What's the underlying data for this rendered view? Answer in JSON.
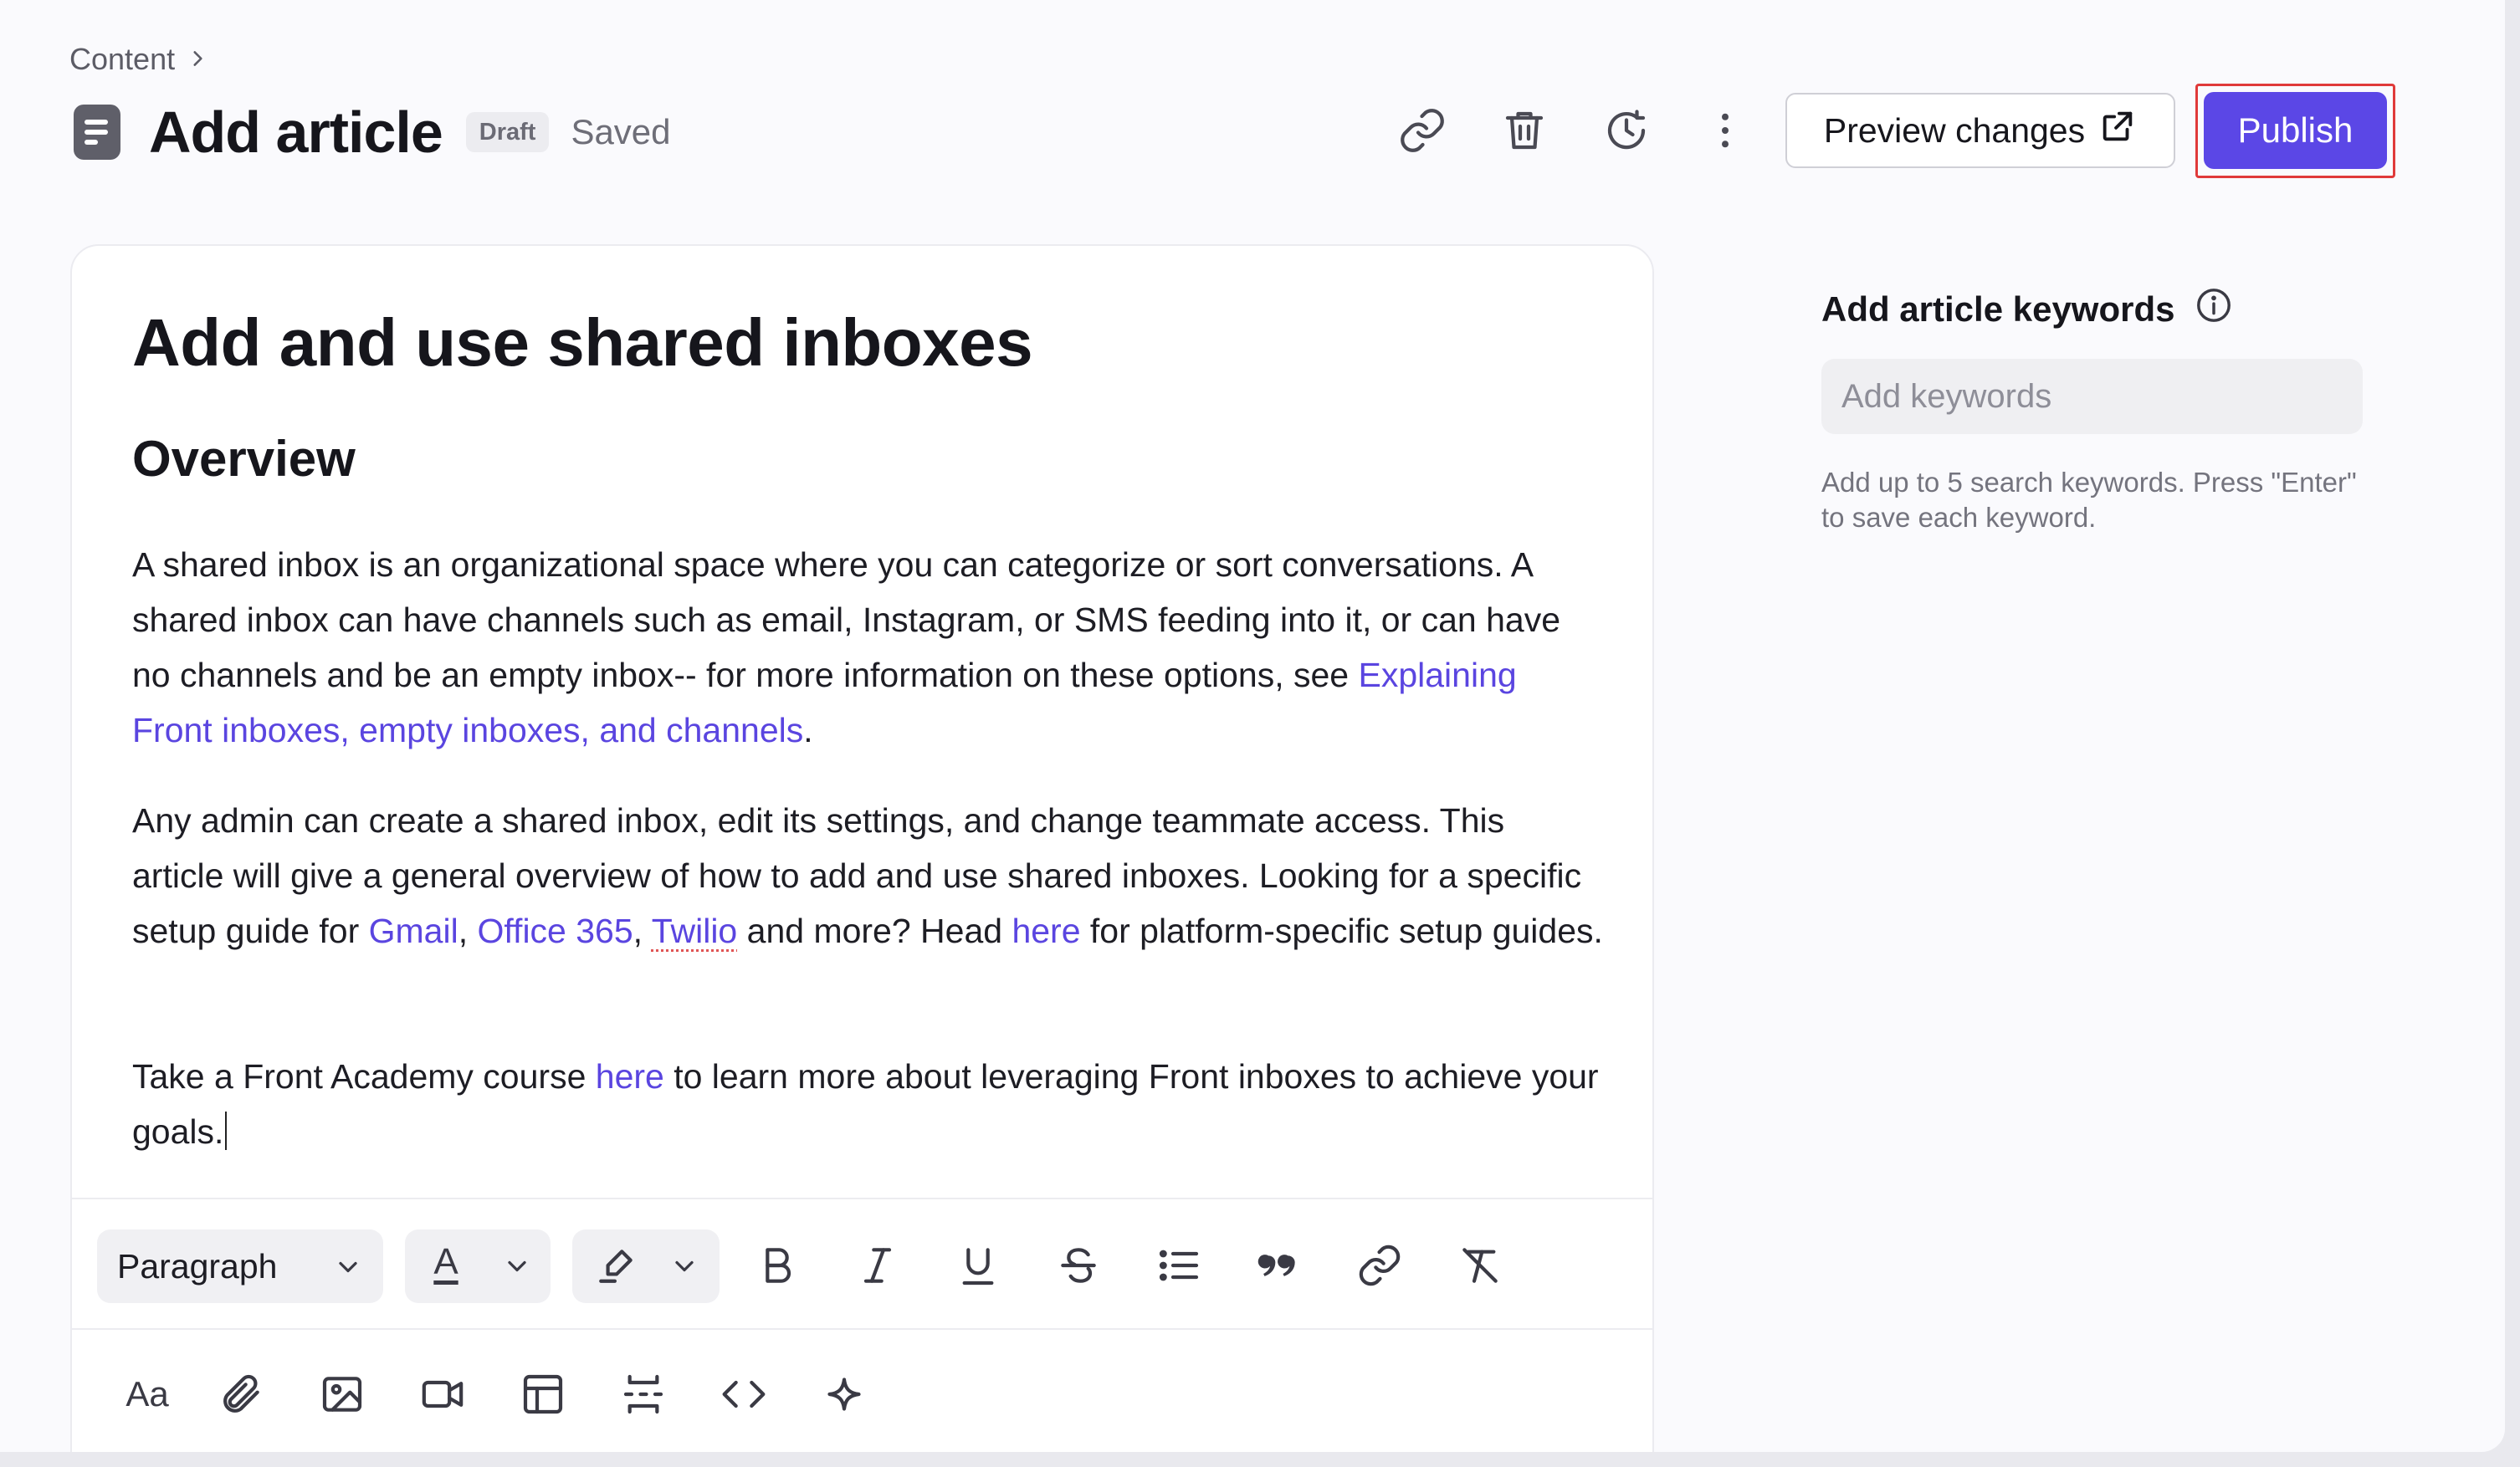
{
  "breadcrumb": {
    "label": "Content"
  },
  "header": {
    "title": "Add article",
    "status_badge": "Draft",
    "save_state": "Saved",
    "preview_label": "Preview changes",
    "publish_label": "Publish"
  },
  "article": {
    "title": "Add and use shared inboxes",
    "heading": "Overview",
    "p1": {
      "text": "A shared inbox is an organizational space where you can categorize or sort conversations. A shared inbox can have channels such as email, Instagram, or SMS feeding into it, or can have no channels and be an empty inbox-- for more information on these options, see ",
      "link": "Explaining Front inboxes, empty inboxes, and channels",
      "end": "."
    },
    "p2": {
      "text": "Any admin can create a shared inbox, edit its settings, and change teammate access. This article will give a general overview of how to add and use shared inboxes. Looking for a specific setup guide for ",
      "link1": "Gmail",
      "sep1": ", ",
      "link2": "Office 365",
      "sep2": ", ",
      "link3": "Twilio",
      "mid": " and more? Head ",
      "link4": "here",
      "end": " for platform-specific setup guides."
    },
    "p3": {
      "text": "Take a Front Academy course ",
      "link": "here",
      "end": " to learn more about leveraging Front inboxes to achieve your goals."
    }
  },
  "toolbar": {
    "block_style": "Paragraph",
    "text_color_glyph": "A",
    "font_size_glyph": "Aa",
    "icons_row1": [
      "bold-icon",
      "italic-icon",
      "underline-icon",
      "strikethrough-icon",
      "bulleted-list-icon",
      "quote-icon",
      "link-icon",
      "clear-formatting-icon"
    ],
    "icons_row2": [
      "font-size-icon",
      "attachment-icon",
      "image-icon",
      "video-icon",
      "table-icon",
      "divider-icon",
      "code-icon",
      "ai-sparkle-icon"
    ]
  },
  "keywords": {
    "heading": "Add article keywords",
    "placeholder": "Add keywords",
    "help": "Add up to 5 search keywords. Press \"Enter\" to save each keyword."
  },
  "colors": {
    "accent": "#5b47e6",
    "link": "#5a45e0",
    "highlight_outline": "#e03a3a"
  }
}
